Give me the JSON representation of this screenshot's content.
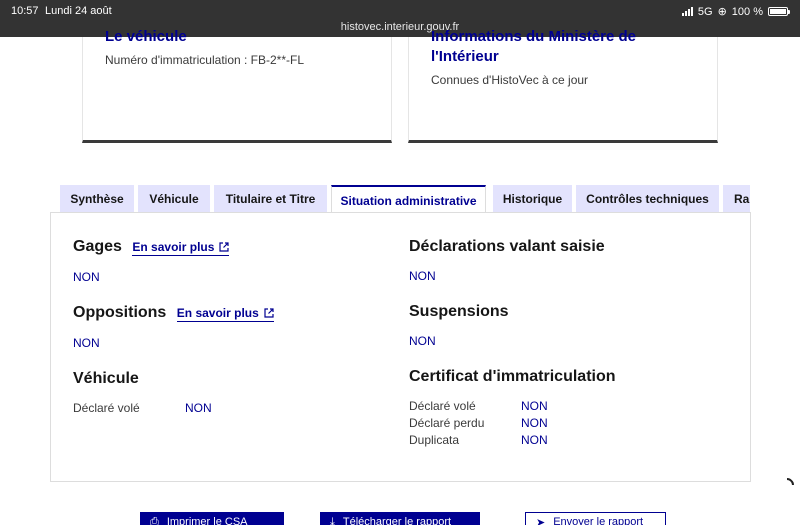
{
  "status_bar": {
    "time": "10:57",
    "date": "Lundi 24 août",
    "network": "5G",
    "battery": "100 %"
  },
  "browser": {
    "url": "histovec.interieur.gouv.fr"
  },
  "cards": {
    "vehicle": {
      "title": "Le véhicule",
      "text": "Numéro d'immatriculation : FB-2**-FL"
    },
    "ministry": {
      "title": "Informations du Ministère de l'Intérieur",
      "text": "Connues d'HistoVec à ce jour"
    }
  },
  "tabs": [
    {
      "label": "Synthèse",
      "active": false
    },
    {
      "label": "Véhicule",
      "active": false
    },
    {
      "label": "Titulaire et Titre",
      "active": false
    },
    {
      "label": "Situation administrative",
      "active": true
    },
    {
      "label": "Historique",
      "active": false
    },
    {
      "label": "Contrôles techniques",
      "active": false
    },
    {
      "label": "Rap",
      "active": false
    }
  ],
  "panel": {
    "gages": {
      "title": "Gages",
      "link": "En savoir plus",
      "value": "NON"
    },
    "oppositions": {
      "title": "Oppositions",
      "link": "En savoir plus",
      "value": "NON"
    },
    "vehicule": {
      "title": "Véhicule",
      "label": "Déclaré volé",
      "value": "NON"
    },
    "declarations": {
      "title": "Déclarations valant saisie",
      "value": "NON"
    },
    "suspensions": {
      "title": "Suspensions",
      "value": "NON"
    },
    "certificat": {
      "title": "Certificat d'immatriculation",
      "rows": [
        {
          "label": "Déclaré volé",
          "value": "NON"
        },
        {
          "label": "Déclaré perdu",
          "value": "NON"
        },
        {
          "label": "Duplicata",
          "value": "NON"
        }
      ]
    }
  },
  "buttons": {
    "print": "Imprimer le CSA",
    "download": "Télécharger le rapport",
    "send": "Envoyer le rapport"
  },
  "colors": {
    "primary": "#000091",
    "tab_background": "#e3e3fd",
    "topbar": "#333333"
  }
}
